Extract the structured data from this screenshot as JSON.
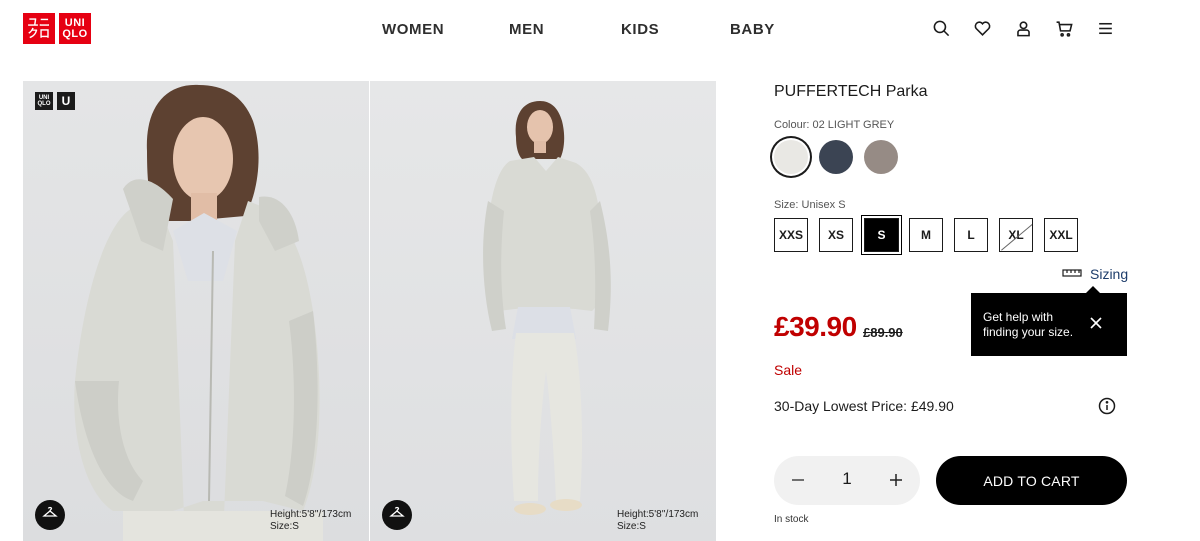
{
  "brand": {
    "logo_left": [
      "ユニ",
      "クロ"
    ],
    "logo_right": [
      "UNI",
      "QLO"
    ],
    "color": "#e60012"
  },
  "nav": {
    "items": [
      "WOMEN",
      "MEN",
      "KIDS",
      "BABY"
    ]
  },
  "header_icons": [
    "search-icon",
    "heart-icon",
    "user-icon",
    "cart-icon",
    "menu-icon"
  ],
  "gallery": {
    "badge_uniqlo": "UNI QLO",
    "badge_u": "U",
    "photos": [
      {
        "model_height": "Height:5'8''/173cm",
        "model_size": "Size:S"
      },
      {
        "model_height": "Height:5'8''/173cm",
        "model_size": "Size:S"
      }
    ]
  },
  "product": {
    "title": "PUFFERTECH Parka",
    "colour_label": "Colour: 02 LIGHT GREY",
    "swatches": [
      {
        "name": "light-grey",
        "color": "#e9e8e4",
        "selected": true
      },
      {
        "name": "navy",
        "color": "#3b4453",
        "selected": false
      },
      {
        "name": "taupe",
        "color": "#968b85",
        "selected": false
      }
    ],
    "size_label": "Size: Unisex S",
    "sizes": [
      {
        "label": "XXS",
        "selected": false,
        "out_of_stock": false
      },
      {
        "label": "XS",
        "selected": false,
        "out_of_stock": false
      },
      {
        "label": "S",
        "selected": true,
        "out_of_stock": false
      },
      {
        "label": "M",
        "selected": false,
        "out_of_stock": false
      },
      {
        "label": "L",
        "selected": false,
        "out_of_stock": false
      },
      {
        "label": "XL",
        "selected": false,
        "out_of_stock": true
      },
      {
        "label": "XXL",
        "selected": false,
        "out_of_stock": false
      }
    ],
    "sizing_link": "Sizing",
    "tooltip": {
      "line1": "Get help with",
      "line2": "finding your size."
    },
    "price": "£39.90",
    "old_price": "£89.90",
    "sale_label": "Sale",
    "lowest_price": "30-Day Lowest Price: £49.90",
    "quantity": "1",
    "add_to_cart": "ADD TO CART",
    "stock_status": "In stock",
    "price_color": "#c00000"
  }
}
